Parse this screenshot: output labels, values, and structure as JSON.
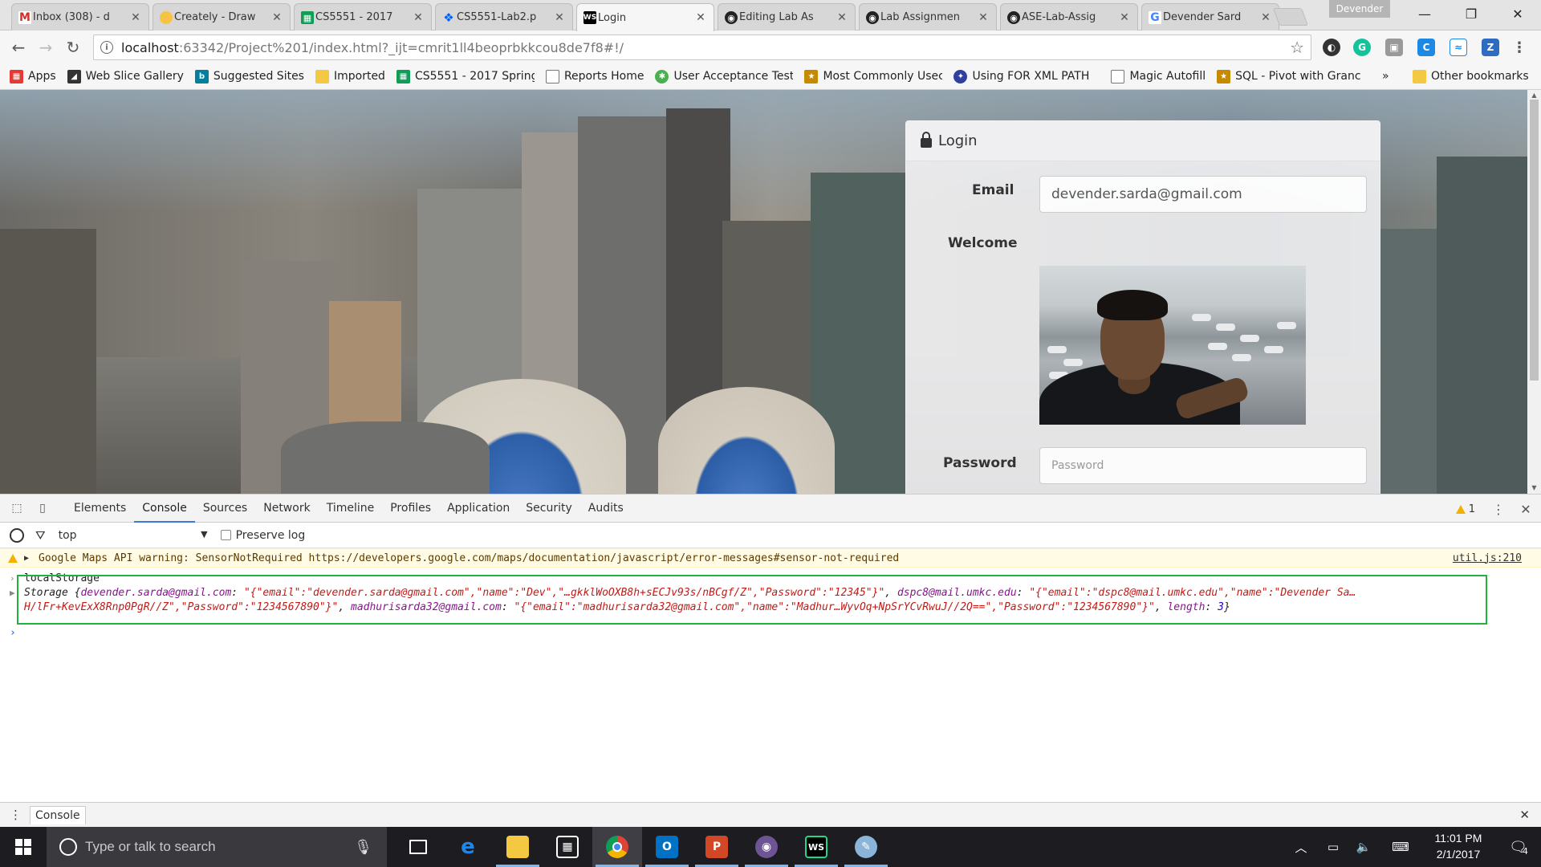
{
  "browser": {
    "tabs": [
      {
        "title": "Inbox (308) - d",
        "icon": "gmail-icon",
        "color": "#d93025",
        "active": false
      },
      {
        "title": "Creately - Draw",
        "icon": "creately-icon",
        "color": "#f6c342",
        "active": false
      },
      {
        "title": "CS5551 - 2017",
        "icon": "sheets-icon",
        "color": "#0f9d58",
        "active": false
      },
      {
        "title": "CS5551-Lab2.p",
        "icon": "dropbox-icon",
        "color": "#0061ff",
        "active": false
      },
      {
        "title": "Login",
        "icon": "webstorm-icon",
        "color": "#000000",
        "active": true
      },
      {
        "title": "Editing Lab As",
        "icon": "github-icon",
        "color": "#222222",
        "active": false
      },
      {
        "title": "Lab Assignmen",
        "icon": "github-icon",
        "color": "#222222",
        "active": false
      },
      {
        "title": "ASE-Lab-Assig",
        "icon": "github-icon",
        "color": "#222222",
        "active": false
      },
      {
        "title": "Devender Sard",
        "icon": "google-icon",
        "color": "#4285f4",
        "active": false
      }
    ],
    "profile_name": "Devender",
    "address": {
      "host": "localhost",
      "rest": ":63342/Project%201/index.html?_ijt=cmrit1ll4beoprbkkcou8de7f8#!/"
    },
    "bookmarks": [
      {
        "label": "Apps",
        "icon": "apps-grid-icon",
        "color": "#e53935"
      },
      {
        "label": "Web Slice Gallery",
        "icon": "web-slice-icon",
        "color": "#333333"
      },
      {
        "label": "Suggested Sites",
        "icon": "bing-icon",
        "color": "#00809d"
      },
      {
        "label": "Imported",
        "icon": "folder-icon",
        "color": "#f5c842"
      },
      {
        "label": "CS5551 - 2017 Spring",
        "icon": "sheets-icon",
        "color": "#0f9d58"
      },
      {
        "label": "Reports Home",
        "icon": "page-icon",
        "color": "#777777"
      },
      {
        "label": "User Acceptance Testi",
        "icon": "bug-icon",
        "color": "#4caf50"
      },
      {
        "label": "Most Commonly Usec",
        "icon": "award-icon",
        "color": "#c58a00"
      },
      {
        "label": "Using FOR XML PATH",
        "icon": "flag-icon",
        "color": "#3040a0"
      },
      {
        "label": "Magic Autofill",
        "icon": "page-icon",
        "color": "#777777"
      },
      {
        "label": "SQL - Pivot with Granc",
        "icon": "award-icon",
        "color": "#c58a00"
      }
    ],
    "bookmarks_overflow": "»",
    "other_bookmarks": "Other bookmarks"
  },
  "page": {
    "panel_title": "Login",
    "email_label": "Email",
    "email_value": "devender.sarda@gmail.com",
    "welcome_label": "Welcome",
    "password_label": "Password",
    "password_placeholder": "Password"
  },
  "devtools": {
    "tabs": [
      "Elements",
      "Console",
      "Sources",
      "Network",
      "Timeline",
      "Profiles",
      "Application",
      "Security",
      "Audits"
    ],
    "active_tab": "Console",
    "warning_count": "1",
    "context": "top",
    "preserve_log": "Preserve log",
    "warning_message": "Google Maps API warning: SensorNotRequired https://developers.google.com/maps/documentation/javascript/error-messages#sensor-not-required",
    "warning_source": "util.js:210",
    "input_command": "localStorage",
    "storage_prefix": "Storage {",
    "entries": [
      {
        "key": "devender.sarda@gmail.com",
        "value": "\"{\"email\":\"devender.sarda@gmail.com\",\"name\":\"Dev\",\"…gkklWoOXB8h+sECJv93s/nBCgf/Z\",\"Password\":\"12345\"}\""
      },
      {
        "key": "dspc8@mail.umkc.edu",
        "value": "\"{\"email\":\"dspc8@mail.umkc.edu\",\"name\":\"Devender Sa…"
      },
      {
        "key": "madhurisarda32@gmail.com",
        "value": "\"{\"email\":\"madhurisarda32@gmail.com\",\"name\":\"Madhur…WyvOq+NpSrYCvRwuJ//2Q==\",\"Password\":\"1234567890\"}\""
      }
    ],
    "line2_prefix": "H/lFr+KevExX8Rnp0PgR//Z\",\"Password\":\"1234567890\"}\"",
    "length_key": "length",
    "length_value": "3",
    "drawer_tab": "Console"
  },
  "taskbar": {
    "search_placeholder": "Type or talk to search",
    "time": "11:01 PM",
    "date": "2/1/2017",
    "notification_count": "4",
    "apps": [
      {
        "name": "task-view",
        "icon": "task-view-icon"
      },
      {
        "name": "edge",
        "icon": "edge-icon",
        "color": "#1e88e5"
      },
      {
        "name": "file-explorer",
        "icon": "folder-icon",
        "color": "#f5c842"
      },
      {
        "name": "store",
        "icon": "store-icon",
        "color": "#ffffff"
      },
      {
        "name": "chrome",
        "icon": "chrome-icon",
        "color": "#db4437"
      },
      {
        "name": "outlook",
        "icon": "outlook-icon",
        "color": "#0072c6"
      },
      {
        "name": "powerpoint",
        "icon": "powerpoint-icon",
        "color": "#d24726"
      },
      {
        "name": "github-desktop",
        "icon": "github-icon",
        "color": "#6e5494"
      },
      {
        "name": "webstorm",
        "icon": "webstorm-icon",
        "color": "#21d789"
      },
      {
        "name": "paint",
        "icon": "paint-icon",
        "color": "#8ab4d8"
      }
    ]
  }
}
